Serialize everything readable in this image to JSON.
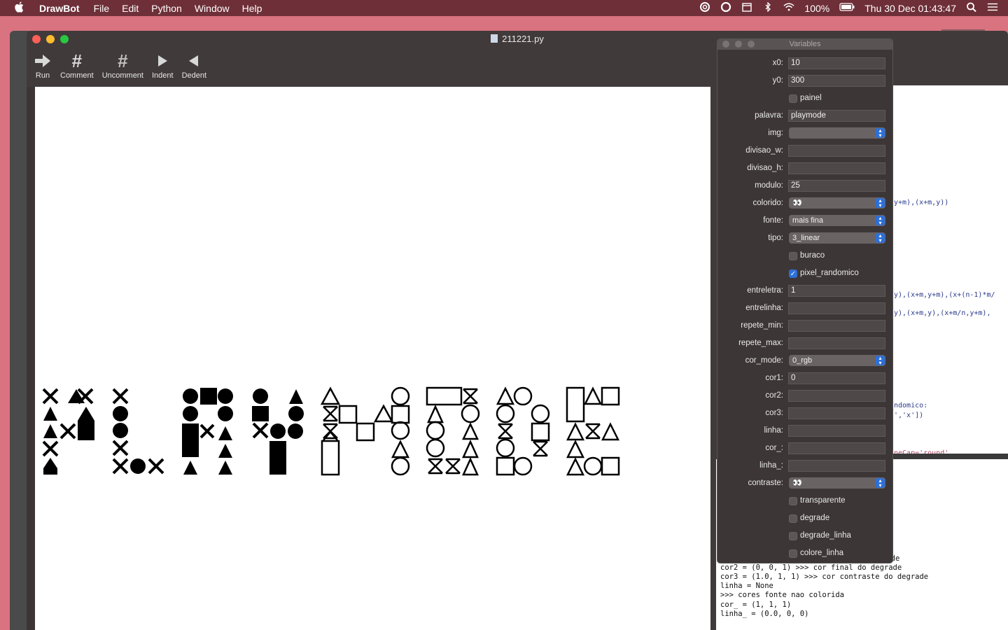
{
  "menubar": {
    "app_name": "DrawBot",
    "menus": [
      "File",
      "Edit",
      "Python",
      "Window",
      "Help"
    ],
    "battery": "100%",
    "clock": "Thu 30 Dec  01:43:47"
  },
  "window": {
    "title": "211221.py"
  },
  "toolbar": {
    "run": "Run",
    "comment": "Comment",
    "uncomment": "Uncomment",
    "indent": "Indent",
    "dedent": "Dedent"
  },
  "editor": {
    "lines": [
      "y+m),(x+m,y))",
      "y),(x+m,y+m),(x+(n-1)*m/",
      "y),(x+m,y),(x+m/n,y+m),",
      "ndomico:",
      "','x'])",
      "neCap='round'"
    ]
  },
  "console": {
    "lines": [
      "rade",
      "cor2 = (0, 0, 1) >>> cor final do degrade",
      "cor3 = (1.0, 1, 1) >>> cor contraste do degrade",
      "linha = None",
      ">>> cores fonte nao colorida",
      "cor_ = (1, 1, 1)",
      "linha_ = (0.0, 0, 0)"
    ]
  },
  "variables": {
    "title": "Variables",
    "fields": [
      {
        "kind": "input",
        "label": "x0:",
        "value": "10"
      },
      {
        "kind": "input",
        "label": "y0:",
        "value": "300"
      },
      {
        "kind": "check",
        "label": "painel",
        "checked": false
      },
      {
        "kind": "input",
        "label": "palavra:",
        "value": "playmode"
      },
      {
        "kind": "select",
        "label": "img:",
        "value": ""
      },
      {
        "kind": "input",
        "label": "divisao_w:",
        "value": ""
      },
      {
        "kind": "input",
        "label": "divisao_h:",
        "value": ""
      },
      {
        "kind": "input",
        "label": "modulo:",
        "value": "25"
      },
      {
        "kind": "select",
        "label": "colorido:",
        "value": "👀"
      },
      {
        "kind": "select",
        "label": "fonte:",
        "value": "mais fina"
      },
      {
        "kind": "select",
        "label": "tipo:",
        "value": "3_linear"
      },
      {
        "kind": "check",
        "label": "buraco",
        "checked": false
      },
      {
        "kind": "check",
        "label": "pixel_randomico",
        "checked": true
      },
      {
        "kind": "input",
        "label": "entreletra:",
        "value": "1"
      },
      {
        "kind": "input",
        "label": "entrelinha:",
        "value": ""
      },
      {
        "kind": "input",
        "label": "repete_min:",
        "value": ""
      },
      {
        "kind": "input",
        "label": "repete_max:",
        "value": ""
      },
      {
        "kind": "select",
        "label": "cor_mode:",
        "value": "0_rgb"
      },
      {
        "kind": "input",
        "label": "cor1:",
        "value": "0"
      },
      {
        "kind": "input",
        "label": "cor2:",
        "value": ""
      },
      {
        "kind": "input",
        "label": "cor3:",
        "value": ""
      },
      {
        "kind": "input",
        "label": "linha:",
        "value": ""
      },
      {
        "kind": "input",
        "label": "cor_:",
        "value": ""
      },
      {
        "kind": "input",
        "label": "linha_:",
        "value": ""
      },
      {
        "kind": "select",
        "label": "contraste:",
        "value": "👀"
      },
      {
        "kind": "check",
        "label": "transparente",
        "checked": false
      },
      {
        "kind": "check",
        "label": "degrade",
        "checked": false
      },
      {
        "kind": "check",
        "label": "degrade_linha",
        "checked": false
      },
      {
        "kind": "check",
        "label": "colore_linha",
        "checked": false
      }
    ]
  },
  "colors": {
    "desktop": "#d9737f",
    "menubar": "#6e2f38",
    "accent": "#2d6fd8"
  }
}
